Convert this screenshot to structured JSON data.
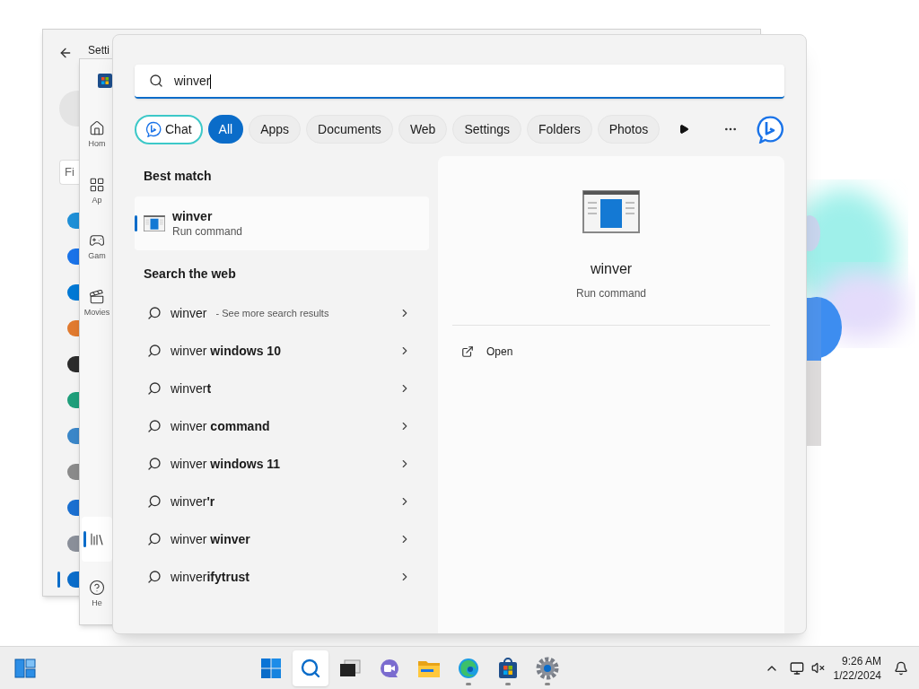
{
  "settings_window": {
    "title": "Setti",
    "search_placeholder": "Fi",
    "nav": [
      {
        "selected": false
      },
      {
        "selected": false
      },
      {
        "selected": false
      },
      {
        "selected": false
      },
      {
        "selected": false
      },
      {
        "selected": false
      },
      {
        "selected": false
      },
      {
        "selected": false
      },
      {
        "selected": false
      },
      {
        "selected": false
      },
      {
        "selected": true
      }
    ]
  },
  "store_window": {
    "nav": [
      {
        "kind": "home",
        "label": "Hom",
        "selected": false
      },
      {
        "kind": "apps",
        "label": "Ap",
        "selected": false
      },
      {
        "kind": "gaming",
        "label": "Gam",
        "selected": false
      },
      {
        "kind": "movies",
        "label": "Movies",
        "selected": false
      },
      {
        "kind": "library",
        "selected": true
      },
      {
        "kind": "help",
        "label": "He",
        "selected": false
      }
    ]
  },
  "search": {
    "query": "winver",
    "filters": [
      {
        "kind": "chat",
        "label": "Chat",
        "selected": false
      },
      {
        "kind": "text",
        "label": "All",
        "selected": true
      },
      {
        "kind": "text",
        "label": "Apps",
        "selected": false
      },
      {
        "kind": "text",
        "label": "Documents",
        "selected": false
      },
      {
        "kind": "text",
        "label": "Web",
        "selected": false
      },
      {
        "kind": "text",
        "label": "Settings",
        "selected": false
      },
      {
        "kind": "text",
        "label": "Folders",
        "selected": false
      },
      {
        "kind": "text",
        "label": "Photos",
        "selected": false
      }
    ],
    "best_match": {
      "heading": "Best match",
      "title": "winver",
      "subtitle": "Run command",
      "selected": true
    },
    "web": {
      "heading": "Search the web",
      "items": [
        {
          "text": "winver",
          "suffix": "- See more search results"
        },
        {
          "text": "winver **windows 10**"
        },
        {
          "text": "winver**t**"
        },
        {
          "text": "winver **command**"
        },
        {
          "text": "winver **windows 11**"
        },
        {
          "text": "winver**'r**"
        },
        {
          "text": "winver **winver**"
        },
        {
          "text": "winver**ifytrust**"
        }
      ]
    },
    "preview": {
      "title": "winver",
      "subtitle": "Run command",
      "actions": [
        "Open"
      ]
    }
  },
  "taskbar": {
    "apps": [
      {
        "kind": "start",
        "selected": false,
        "running": false
      },
      {
        "kind": "search",
        "selected": true,
        "running": false
      },
      {
        "kind": "taskview",
        "selected": false,
        "running": false
      },
      {
        "kind": "chat",
        "selected": false,
        "running": false
      },
      {
        "kind": "explorer",
        "selected": false,
        "running": false
      },
      {
        "kind": "edge",
        "selected": false,
        "running": true
      },
      {
        "kind": "store",
        "selected": false,
        "running": true
      },
      {
        "kind": "settings",
        "selected": false,
        "running": true
      }
    ],
    "time": "9:26 AM",
    "date": "1/22/2024"
  }
}
